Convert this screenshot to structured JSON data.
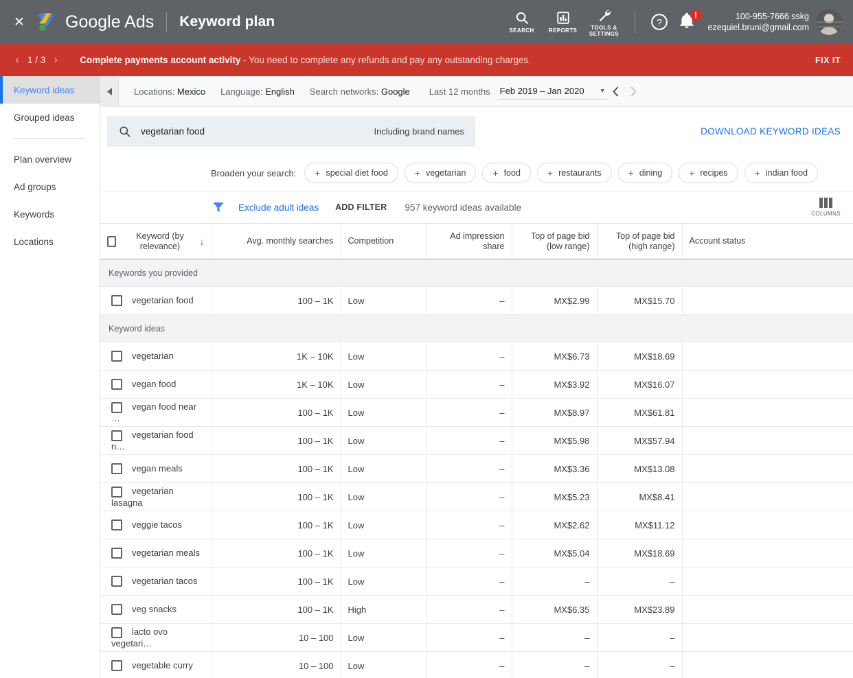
{
  "header": {
    "close_label": "✕",
    "brand": "Google Ads",
    "app_title": "Keyword plan",
    "tools": [
      {
        "label": "SEARCH",
        "icon": "search-icon"
      },
      {
        "label": "REPORTS",
        "icon": "reports-icon"
      },
      {
        "label": "TOOLS & SETTINGS",
        "icon": "wrench-icon"
      }
    ],
    "help_icon": "help-icon",
    "notifications_icon": "bell-icon",
    "notification_badge": "!",
    "account_id": "100-955-7666 sskg",
    "account_email": "ezequiel.bruni@gmail.com",
    "avatar": "user-avatar"
  },
  "alert": {
    "prev": "‹",
    "counter": "1 / 3",
    "next": "›",
    "title": "Complete payments account activity",
    "message": "- You need to complete any refunds and pay any outstanding charges.",
    "action": "FIX IT",
    "color": "#c9372c"
  },
  "sidebar": {
    "items": [
      {
        "label": "Keyword ideas",
        "active": true
      },
      {
        "label": "Grouped ideas",
        "active": false
      },
      {
        "label": "Plan overview",
        "active": false
      },
      {
        "label": "Ad groups",
        "active": false
      },
      {
        "label": "Keywords",
        "active": false
      },
      {
        "label": "Locations",
        "active": false
      }
    ],
    "active_color": "#1a73e8"
  },
  "settings_bar": {
    "collapse_icon": "collapse-left-icon",
    "locations_label": "Locations:",
    "locations_value": "Mexico",
    "language_label": "Language:",
    "language_value": "English",
    "networks_label": "Search networks:",
    "networks_value": "Google",
    "range_label": "Last 12 months",
    "range_value": "Feb 2019 – Jan 2020",
    "caret": "▼",
    "prev": "‹",
    "next": "›"
  },
  "search": {
    "icon": "search-icon",
    "keyword": "vegetarian food",
    "brand_names": "Including brand names",
    "download": "DOWNLOAD KEYWORD IDEAS"
  },
  "broaden": {
    "label": "Broaden your search:",
    "chips": [
      "special diet food",
      "vegetarian",
      "food",
      "restaurants",
      "dining",
      "recipes",
      "indian food"
    ]
  },
  "filters": {
    "funnel_icon": "filter-funnel-icon",
    "exclude_adult": "Exclude adult ideas",
    "add_filter": "ADD FILTER",
    "available": "957 keyword ideas available",
    "columns_label": "COLUMNS",
    "columns_icon": "columns-icon"
  },
  "table": {
    "columns": [
      "Keyword (by relevance)",
      "Avg. monthly searches",
      "Competition",
      "Ad impression share",
      "Top of page bid (low range)",
      "Top of page bid (high range)",
      "Account status"
    ],
    "sort_indicator": "↓",
    "groups": [
      {
        "title": "Keywords you provided",
        "rows": [
          {
            "keyword": "vegetarian food",
            "searches": "100 – 1K",
            "competition": "Low",
            "impression_share": "–",
            "bid_low": "MX$2.99",
            "bid_high": "MX$15.70",
            "account_status": ""
          }
        ]
      },
      {
        "title": "Keyword ideas",
        "rows": [
          {
            "keyword": "vegetarian",
            "searches": "1K – 10K",
            "competition": "Low",
            "impression_share": "–",
            "bid_low": "MX$6.73",
            "bid_high": "MX$18.69",
            "account_status": ""
          },
          {
            "keyword": "vegan food",
            "searches": "1K – 10K",
            "competition": "Low",
            "impression_share": "–",
            "bid_low": "MX$3.92",
            "bid_high": "MX$16.07",
            "account_status": ""
          },
          {
            "keyword": "vegan food near …",
            "searches": "100 – 1K",
            "competition": "Low",
            "impression_share": "–",
            "bid_low": "MX$8.97",
            "bid_high": "MX$61.81",
            "account_status": ""
          },
          {
            "keyword": "vegetarian food n…",
            "searches": "100 – 1K",
            "competition": "Low",
            "impression_share": "–",
            "bid_low": "MX$5.98",
            "bid_high": "MX$57.94",
            "account_status": ""
          },
          {
            "keyword": "vegan meals",
            "searches": "100 – 1K",
            "competition": "Low",
            "impression_share": "–",
            "bid_low": "MX$3.36",
            "bid_high": "MX$13.08",
            "account_status": ""
          },
          {
            "keyword": "vegetarian lasagna",
            "searches": "100 – 1K",
            "competition": "Low",
            "impression_share": "–",
            "bid_low": "MX$5.23",
            "bid_high": "MX$8.41",
            "account_status": ""
          },
          {
            "keyword": "veggie tacos",
            "searches": "100 – 1K",
            "competition": "Low",
            "impression_share": "–",
            "bid_low": "MX$2.62",
            "bid_high": "MX$11.12",
            "account_status": ""
          },
          {
            "keyword": "vegetarian meals",
            "searches": "100 – 1K",
            "competition": "Low",
            "impression_share": "–",
            "bid_low": "MX$5.04",
            "bid_high": "MX$18.69",
            "account_status": ""
          },
          {
            "keyword": "vegetarian tacos",
            "searches": "100 – 1K",
            "competition": "Low",
            "impression_share": "–",
            "bid_low": "–",
            "bid_high": "–",
            "account_status": ""
          },
          {
            "keyword": "veg snacks",
            "searches": "100 – 1K",
            "competition": "High",
            "impression_share": "–",
            "bid_low": "MX$6.35",
            "bid_high": "MX$23.89",
            "account_status": ""
          },
          {
            "keyword": "lacto ovo vegetari…",
            "searches": "10 – 100",
            "competition": "Low",
            "impression_share": "–",
            "bid_low": "–",
            "bid_high": "–",
            "account_status": ""
          },
          {
            "keyword": "vegetable curry",
            "searches": "10 – 100",
            "competition": "Low",
            "impression_share": "–",
            "bid_low": "–",
            "bid_high": "–",
            "account_status": ""
          }
        ]
      }
    ]
  }
}
